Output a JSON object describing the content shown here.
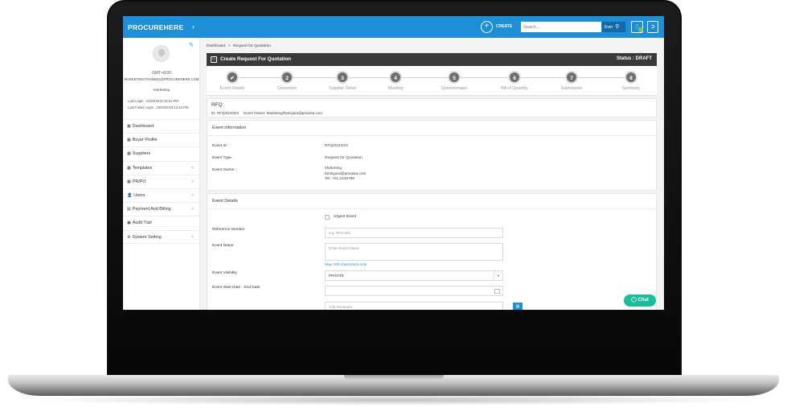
{
  "header": {
    "brand": "PROCUREHERE",
    "toggle_icon": "chevron-left-icon",
    "create_label": "CREATE",
    "search_placeholder": "Search...",
    "search_scope": "Ever",
    "accent_color": "#1e8fd6"
  },
  "profile": {
    "timezone": "GMT+8:00",
    "email": "MARKETINGTRAINING@PROCUREHERE.COM",
    "department": "Marketing",
    "last_login": "Last Login : 22/03/2018 15:51 PM",
    "last_failed_login": "Last Failed Login : 22/03/2018 12:12 PM"
  },
  "sidebar": {
    "items": [
      {
        "icon": "▦",
        "label": "Dashboard",
        "chevron": ""
      },
      {
        "icon": "▦",
        "label": "Buyer Profile",
        "chevron": ""
      },
      {
        "icon": "▦",
        "label": "Suppliers",
        "chevron": ""
      },
      {
        "icon": "▦",
        "label": "Templates",
        "chevron": ">"
      },
      {
        "icon": "▦",
        "label": "PR/PO",
        "chevron": ">"
      },
      {
        "icon": "👤",
        "label": "Users",
        "chevron": ">"
      },
      {
        "icon": "▤",
        "label": "Payment And Billing",
        "chevron": ">"
      },
      {
        "icon": "▣",
        "label": "Audit Trail",
        "chevron": ""
      },
      {
        "icon": "⚙",
        "label": "System Setting",
        "chevron": ">"
      }
    ]
  },
  "breadcrumb": {
    "home": "Dashboard",
    "separator": ">",
    "current": "Request for Quotation"
  },
  "title_bar": {
    "title": "Create Request For Quotation",
    "status": "Status : DRAFT"
  },
  "steps": [
    {
      "marker": "✔",
      "label": "Event Details"
    },
    {
      "marker": "2",
      "label": "Document"
    },
    {
      "marker": "3",
      "label": "Supplier Detail"
    },
    {
      "marker": "4",
      "label": "Meeting"
    },
    {
      "marker": "5",
      "label": "Questionnaire"
    },
    {
      "marker": "6",
      "label": "Bill of Quantity"
    },
    {
      "marker": "7",
      "label": "Submission"
    },
    {
      "marker": "8",
      "label": "Summary"
    }
  ],
  "rfq": {
    "title": "RFQ:",
    "id_line": "ID: RFQ/0223/23",
    "owner_line": "Event Owner: Marketing/fantsyara@privasia.com"
  },
  "event_information": {
    "header": "Event Information",
    "event_id_label": "Event Id :",
    "event_id_value": "RFQ/0223/23",
    "event_type_label": "Event Type :",
    "event_type_value": "Request for Quotation",
    "event_owner_label": "Event Owner :",
    "event_owner_name": "Marketing",
    "event_owner_email": "fantsyara@privasia.com",
    "event_owner_tel": "Tel.:+01 2345789"
  },
  "event_details": {
    "header": "Event Details",
    "urgent_label": "Urgent Event",
    "reference_label": "Reference Number",
    "reference_placeholder": "e.g. RFX-001",
    "event_name_label": "Event Name",
    "event_name_placeholder": "Enter Event Name",
    "max_chars_hint": "Max 200 characters only",
    "visibility_label": "Event Visibility",
    "visibility_value": "PRIVATE",
    "dates_label": "Event Start Date - End Date",
    "reminder_placeholder": "Add Reminder"
  },
  "chat": {
    "label": "Chat",
    "color": "#1bbc9b"
  }
}
